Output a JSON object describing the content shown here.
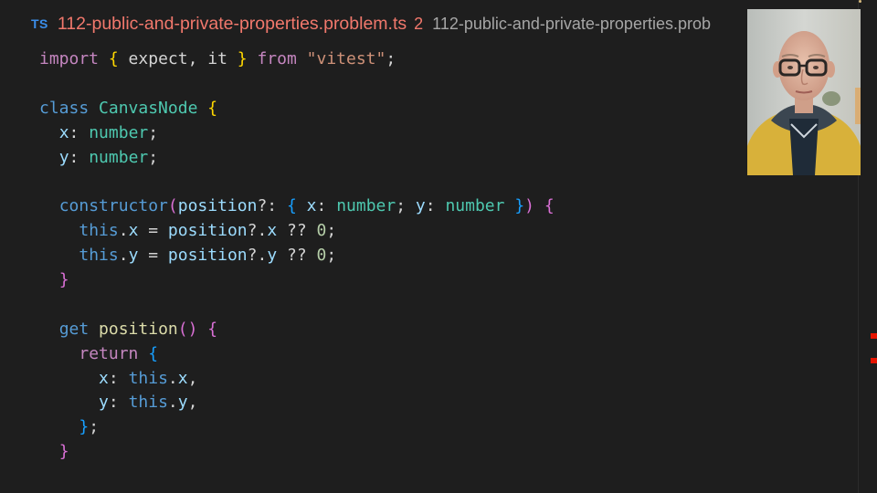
{
  "breadcrumb": {
    "language_badge": "TS",
    "file_name": "112-public-and-private-properties.problem.ts",
    "problem_count": "2",
    "path_text": "112-public-and-private-properties.prob"
  },
  "code": {
    "lines": [
      [
        [
          "kw",
          "import"
        ],
        [
          "pun",
          " "
        ],
        [
          "br1",
          "{"
        ],
        [
          "pun",
          " expect, it "
        ],
        [
          "br1",
          "}"
        ],
        [
          "pun",
          " "
        ],
        [
          "kw",
          "from"
        ],
        [
          "pun",
          " "
        ],
        [
          "str",
          "\"vitest\""
        ],
        [
          "pun",
          ";"
        ]
      ],
      [],
      [
        [
          "kwb",
          "class"
        ],
        [
          "pun",
          " "
        ],
        [
          "cls",
          "CanvasNode"
        ],
        [
          "pun",
          " "
        ],
        [
          "br1",
          "{"
        ]
      ],
      [
        [
          "pun",
          "  "
        ],
        [
          "prop",
          "x"
        ],
        [
          "pun",
          ": "
        ],
        [
          "typ",
          "number"
        ],
        [
          "pun",
          ";"
        ]
      ],
      [
        [
          "pun",
          "  "
        ],
        [
          "prop",
          "y"
        ],
        [
          "pun",
          ": "
        ],
        [
          "typ",
          "number"
        ],
        [
          "pun",
          ";"
        ]
      ],
      [],
      [
        [
          "pun",
          "  "
        ],
        [
          "kwb",
          "constructor"
        ],
        [
          "br2",
          "("
        ],
        [
          "prop",
          "position"
        ],
        [
          "pun",
          "?: "
        ],
        [
          "br3",
          "{"
        ],
        [
          "pun",
          " "
        ],
        [
          "prop",
          "x"
        ],
        [
          "pun",
          ": "
        ],
        [
          "typ",
          "number"
        ],
        [
          "pun",
          "; "
        ],
        [
          "prop",
          "y"
        ],
        [
          "pun",
          ": "
        ],
        [
          "typ",
          "number"
        ],
        [
          "pun",
          " "
        ],
        [
          "br3",
          "}"
        ],
        [
          "br2",
          ")"
        ],
        [
          "pun",
          " "
        ],
        [
          "br2",
          "{"
        ]
      ],
      [
        [
          "pun",
          "    "
        ],
        [
          "kwb",
          "this"
        ],
        [
          "pun",
          "."
        ],
        [
          "prop",
          "x"
        ],
        [
          "pun",
          " = "
        ],
        [
          "prop",
          "position"
        ],
        [
          "pun",
          "?."
        ],
        [
          "prop",
          "x"
        ],
        [
          "pun",
          " ?? "
        ],
        [
          "num",
          "0"
        ],
        [
          "pun",
          ";"
        ]
      ],
      [
        [
          "pun",
          "    "
        ],
        [
          "kwb",
          "this"
        ],
        [
          "pun",
          "."
        ],
        [
          "prop",
          "y"
        ],
        [
          "pun",
          " = "
        ],
        [
          "prop",
          "position"
        ],
        [
          "pun",
          "?."
        ],
        [
          "prop",
          "y"
        ],
        [
          "pun",
          " ?? "
        ],
        [
          "num",
          "0"
        ],
        [
          "pun",
          ";"
        ]
      ],
      [
        [
          "pun",
          "  "
        ],
        [
          "br2",
          "}"
        ]
      ],
      [],
      [
        [
          "pun",
          "  "
        ],
        [
          "kwb",
          "get"
        ],
        [
          "pun",
          " "
        ],
        [
          "fn",
          "position"
        ],
        [
          "br2",
          "()"
        ],
        [
          "pun",
          " "
        ],
        [
          "br2",
          "{"
        ]
      ],
      [
        [
          "pun",
          "    "
        ],
        [
          "kw",
          "return"
        ],
        [
          "pun",
          " "
        ],
        [
          "br3",
          "{"
        ]
      ],
      [
        [
          "pun",
          "      "
        ],
        [
          "prop",
          "x"
        ],
        [
          "pun",
          ": "
        ],
        [
          "kwb",
          "this"
        ],
        [
          "pun",
          "."
        ],
        [
          "prop",
          "x"
        ],
        [
          "pun",
          ","
        ]
      ],
      [
        [
          "pun",
          "      "
        ],
        [
          "prop",
          "y"
        ],
        [
          "pun",
          ": "
        ],
        [
          "kwb",
          "this"
        ],
        [
          "pun",
          "."
        ],
        [
          "prop",
          "y"
        ],
        [
          "pun",
          ","
        ]
      ],
      [
        [
          "pun",
          "    "
        ],
        [
          "br3",
          "}"
        ],
        [
          "pun",
          ";"
        ]
      ],
      [
        [
          "pun",
          "  "
        ],
        [
          "br2",
          "}"
        ]
      ]
    ]
  },
  "markers": {
    "error_color": "#e51400",
    "count": 2
  },
  "webcam": {
    "icon": "presenter-webcam-icon"
  }
}
